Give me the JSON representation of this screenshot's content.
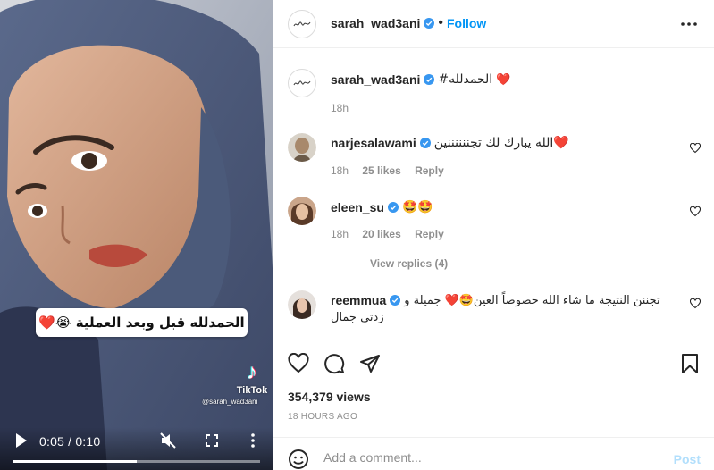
{
  "video": {
    "caption": "الحمدلله قبل وبعد العملية 😭❤️",
    "tiktok_logo": "♪",
    "tiktok_label": "TikTok",
    "tiktok_handle": "@sarah_wad3ani",
    "time": "0:05 / 0:10",
    "progress": 0.5,
    "icons": {
      "play": "play-icon",
      "mute": "muted-speaker-icon",
      "fullscreen": "fullscreen-icon",
      "more": "more-vertical-icon"
    }
  },
  "header": {
    "username": "sarah_wad3ani",
    "separator": "•",
    "follow_label": "Follow",
    "more_icon": "more-horizontal-icon"
  },
  "post": {
    "username": "sarah_wad3ani",
    "caption": "#الحمدلله",
    "heart": "❤️",
    "time": "18h"
  },
  "comments": [
    {
      "username": "narjesalawami",
      "text": "الله يبارك لك تجننننننين❤️",
      "time": "18h",
      "likes": "25 likes",
      "reply": "Reply"
    },
    {
      "username": "eleen_su",
      "text": "🤩🤩",
      "time": "18h",
      "likes": "20 likes",
      "reply": "Reply",
      "view_replies": "View replies (4)"
    },
    {
      "username": "reemmua",
      "text": "تجننن النتيجة ما شاء الله خصوصاً العين🤩❤️ جميلة و",
      "text2": "زدتي جمال"
    }
  ],
  "actions": {
    "views": "354,379 views",
    "ago": "18 HOURS AGO",
    "icons": [
      "heart-icon",
      "comment-icon",
      "share-icon",
      "bookmark-icon"
    ]
  },
  "comment_box": {
    "placeholder": "Add a comment...",
    "post_label": "Post"
  },
  "colors": {
    "accent": "#0095f6",
    "post_disabled": "#b2dffc",
    "muted": "#8e8e8e",
    "hijab": "#4b5a7a"
  }
}
